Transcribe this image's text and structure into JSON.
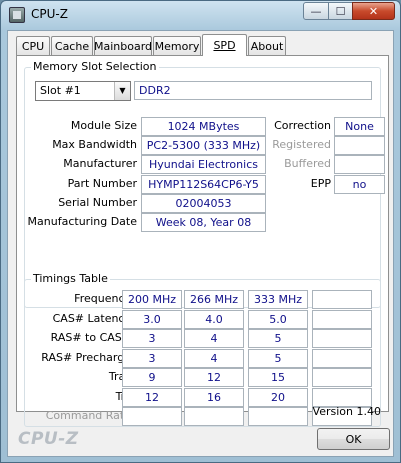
{
  "window": {
    "title": "CPU-Z",
    "close_glyph": "✕",
    "min_glyph": "—",
    "max_glyph": "☐"
  },
  "tabs": [
    {
      "label": "CPU",
      "active": false
    },
    {
      "label": "Cache",
      "active": false
    },
    {
      "label": "Mainboard",
      "active": false
    },
    {
      "label": "Memory",
      "active": false
    },
    {
      "label": "SPD",
      "active": true
    },
    {
      "label": "About",
      "active": false
    }
  ],
  "slot_group": {
    "title": "Memory Slot Selection",
    "selected_slot": "Slot #1",
    "memory_type": "DDR2"
  },
  "module": {
    "labels": {
      "module_size": "Module Size",
      "max_bandwidth": "Max Bandwidth",
      "manufacturer": "Manufacturer",
      "part_number": "Part Number",
      "serial_number": "Serial Number",
      "manufacturing_date": "Manufacturing Date",
      "correction": "Correction",
      "registered": "Registered",
      "buffered": "Buffered",
      "epp": "EPP"
    },
    "values": {
      "module_size": "1024 MBytes",
      "max_bandwidth": "PC2-5300 (333 MHz)",
      "manufacturer": "Hyundai Electronics",
      "part_number": "HYMP112S64CP6-Y5",
      "serial_number": "02004053",
      "manufacturing_date": "Week 08, Year 08",
      "correction": "None",
      "registered": "",
      "buffered": "",
      "epp": "no"
    }
  },
  "timings": {
    "title": "Timings Table",
    "rows": [
      {
        "label": "Frequency",
        "values": [
          "200 MHz",
          "266 MHz",
          "333 MHz",
          ""
        ],
        "dim": false
      },
      {
        "label": "CAS# Latency",
        "values": [
          "3.0",
          "4.0",
          "5.0",
          ""
        ],
        "dim": false
      },
      {
        "label": "RAS# to CAS#",
        "values": [
          "3",
          "4",
          "5",
          ""
        ],
        "dim": false
      },
      {
        "label": "RAS# Precharge",
        "values": [
          "3",
          "4",
          "5",
          ""
        ],
        "dim": false
      },
      {
        "label": "Tras",
        "values": [
          "9",
          "12",
          "15",
          ""
        ],
        "dim": false
      },
      {
        "label": "Trc",
        "values": [
          "12",
          "16",
          "20",
          ""
        ],
        "dim": false
      },
      {
        "label": "Command Rate",
        "values": [
          "",
          "",
          "",
          ""
        ],
        "dim": true
      }
    ]
  },
  "version": "Version 1.40",
  "footer": {
    "logo": "CPU-Z",
    "ok_label": "OK"
  }
}
